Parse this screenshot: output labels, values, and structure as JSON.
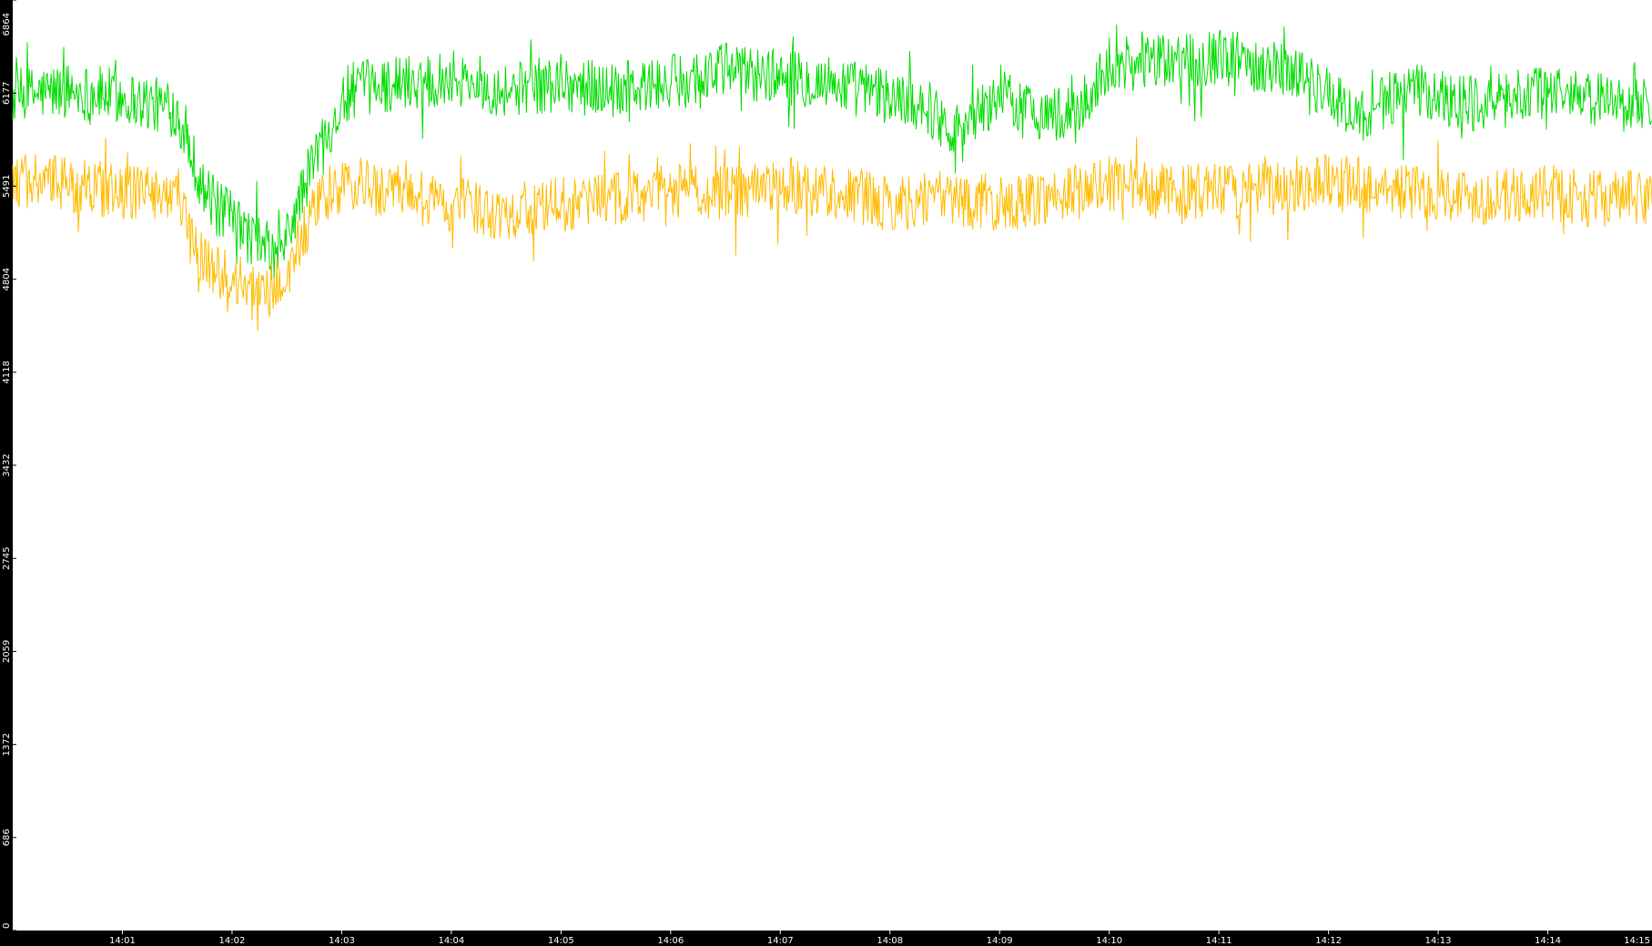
{
  "chart_data": {
    "type": "line",
    "title": "",
    "xlabel": "",
    "ylabel": "",
    "colors": {
      "background": "#000000",
      "plot_background": "#ffffff",
      "tick_text": "#ffffff"
    },
    "grid": false,
    "legend": "none",
    "x_unit": "minutes after 14:00",
    "xlim": [
      0.0,
      14.95
    ],
    "ylim": [
      0,
      6864
    ],
    "x_tick_labels": [
      "14:01",
      "14:02",
      "14:03",
      "14:04",
      "14:05",
      "14:06",
      "14:07",
      "14:08",
      "14:09",
      "14:10",
      "14:11",
      "14:12",
      "14:13",
      "14:14",
      "14:15"
    ],
    "x_tick_values": [
      1,
      2,
      3,
      4,
      5,
      6,
      7,
      8,
      9,
      10,
      11,
      12,
      13,
      14,
      15
    ],
    "y_tick_labels": [
      "0",
      "686",
      "1372",
      "2059",
      "2745",
      "3432",
      "4118",
      "4804",
      "5491",
      "6177",
      "6864"
    ],
    "y_tick_values": [
      0,
      686,
      1372,
      2059,
      2745,
      3432,
      4118,
      4804,
      5491,
      6177,
      6864
    ],
    "series": [
      {
        "color": "#00dd00",
        "x": [
          0.0,
          0.5,
          1.0,
          1.5,
          1.6,
          1.75,
          1.9,
          2.0,
          2.1,
          2.2,
          2.3,
          2.4,
          2.5,
          2.6,
          2.75,
          2.9,
          3.1,
          3.5,
          4.0,
          4.5,
          5.0,
          5.5,
          6.0,
          6.5,
          7.0,
          7.5,
          8.0,
          8.3,
          8.6,
          9.0,
          9.3,
          9.7,
          10.0,
          10.5,
          11.0,
          11.3,
          11.7,
          12.0,
          12.3,
          12.7,
          13.0,
          13.5,
          14.0,
          14.3,
          14.7,
          14.95
        ],
        "y": [
          6150,
          6200,
          6150,
          6050,
          5800,
          5450,
          5300,
          5250,
          5150,
          5100,
          5050,
          4950,
          5100,
          5350,
          5700,
          5950,
          6200,
          6250,
          6300,
          6200,
          6250,
          6200,
          6250,
          6350,
          6300,
          6250,
          6150,
          6100,
          5900,
          6150,
          6050,
          6000,
          6400,
          6400,
          6450,
          6400,
          6350,
          6150,
          6000,
          6200,
          6150,
          6100,
          6200,
          6150,
          6100,
          6100
        ]
      },
      {
        "color": "#ffbb00",
        "x": [
          0.0,
          0.5,
          1.0,
          1.5,
          1.6,
          1.75,
          1.9,
          2.0,
          2.1,
          2.2,
          2.3,
          2.4,
          2.5,
          2.6,
          2.75,
          2.9,
          3.1,
          3.5,
          4.0,
          4.5,
          5.0,
          5.5,
          6.0,
          6.5,
          7.0,
          7.5,
          8.0,
          8.3,
          8.6,
          9.0,
          9.3,
          9.7,
          10.0,
          10.5,
          11.0,
          11.3,
          11.7,
          12.0,
          12.3,
          12.7,
          13.0,
          13.5,
          14.0,
          14.3,
          14.7,
          14.95
        ],
        "y": [
          5550,
          5500,
          5450,
          5450,
          5150,
          4950,
          4850,
          4800,
          4750,
          4700,
          4700,
          4750,
          4800,
          5050,
          5300,
          5450,
          5500,
          5450,
          5350,
          5300,
          5350,
          5400,
          5450,
          5450,
          5500,
          5450,
          5350,
          5400,
          5400,
          5350,
          5400,
          5450,
          5500,
          5450,
          5450,
          5450,
          5500,
          5550,
          5500,
          5450,
          5450,
          5400,
          5450,
          5400,
          5400,
          5400
        ]
      }
    ]
  }
}
